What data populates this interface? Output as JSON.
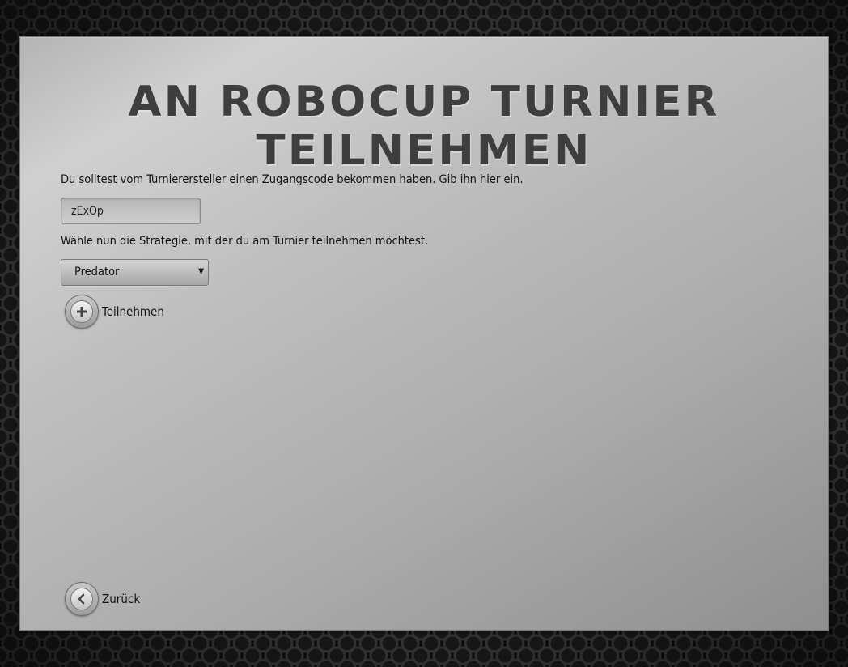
{
  "title": "AN ROBOCUP TURNIER TEILNEHMEN",
  "code_prompt": "Du solltest vom Turnierersteller einen Zugangscode bekommen haben. Gib ihn hier ein.",
  "code_input": {
    "value": "zExOp"
  },
  "strategy_prompt": "Wähle nun die Strategie, mit der du am Turnier teilnehmen möchtest.",
  "strategy_select": {
    "selected": "Predator"
  },
  "join_button": {
    "label": "Teilnehmen",
    "icon": "plus-icon"
  },
  "back_button": {
    "label": "Zurück",
    "icon": "chevron-left-icon"
  }
}
